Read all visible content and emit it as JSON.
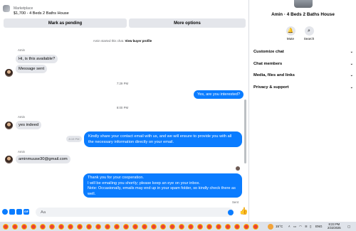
{
  "listing": {
    "marketplace_label": "Marketplace",
    "title": "$1,700 - 4 Beds 2 Baths House"
  },
  "actions": {
    "mark_pending": "Mark as pending",
    "more_options": "More options"
  },
  "chat": {
    "started_text": "Amin started this chat.",
    "view_buyer_profile": "View buyer profile",
    "sender_name": "Amin",
    "messages": {
      "in_1": "Hi, is this available?",
      "in_2": "Message sent",
      "time_1": "7:29 PM",
      "out_1": "Yes, are you interested?",
      "time_2": "8:00 PM",
      "in_3": "yes indeed",
      "hidden_time": "8:19 PM",
      "out_2": "Kindly share your contact email with us, and we will ensure to provide you with all the necessary information directly on your email.",
      "in_4": "aminmuuse30@gmail.com",
      "out_3": "Thank you for your cooperation.\nI will be emailing you shortly; please keep an eye on your inbox.\nNote: Occasionally, emails may end up in your spam folder, so kindly check there as well.",
      "sent_label": "Sent"
    }
  },
  "composer": {
    "placeholder": "Aa",
    "gif_label": "GIF",
    "like_glyph": "👍"
  },
  "info_panel": {
    "title": "Amin · 4 Beds 2 Baths House",
    "mute_label": "Mute",
    "search_label": "Search",
    "sections": [
      "Customize chat",
      "Chat members",
      "Media, files and links",
      "Privacy & support"
    ]
  },
  "taskbar": {
    "temperature": "15°C",
    "language": "ENG",
    "time": "8:23 PM",
    "date": "2/22/2025"
  },
  "colors": {
    "accent": "#0a7cff",
    "incoming_bubble": "#e4e6eb"
  }
}
